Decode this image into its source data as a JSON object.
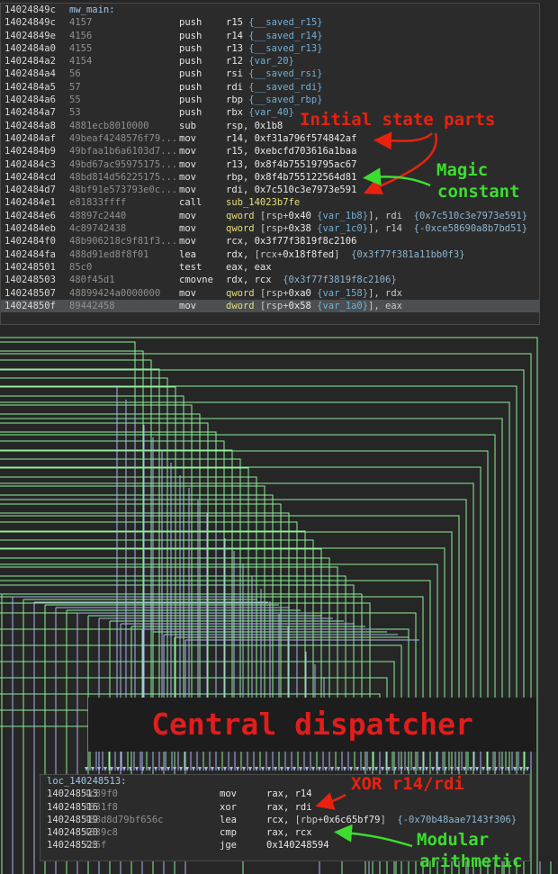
{
  "colors": {
    "background": "#262626",
    "edge_green": "#8eed98",
    "edge_blue": "#a9b4ee",
    "annotation_red": "#e8220f",
    "annotation_green": "#3ddc30",
    "block_bg": "#2b2b2b"
  },
  "top_block": {
    "lines": [
      {
        "addr": "14024849c",
        "label": "mw_main:"
      },
      {
        "addr": "14024849c",
        "bytes": "4157",
        "mnemonic": "push",
        "ops": [
          [
            "r15 ",
            "reg"
          ],
          [
            "{__saved_r15}",
            "var"
          ]
        ]
      },
      {
        "addr": "14024849e",
        "bytes": "4156",
        "mnemonic": "push",
        "ops": [
          [
            "r14 ",
            "reg"
          ],
          [
            "{__saved_r14}",
            "var"
          ]
        ]
      },
      {
        "addr": "1402484a0",
        "bytes": "4155",
        "mnemonic": "push",
        "ops": [
          [
            "r13 ",
            "reg"
          ],
          [
            "{__saved_r13}",
            "var"
          ]
        ]
      },
      {
        "addr": "1402484a2",
        "bytes": "4154",
        "mnemonic": "push",
        "ops": [
          [
            "r12 ",
            "reg"
          ],
          [
            "{var_20}",
            "var"
          ]
        ]
      },
      {
        "addr": "1402484a4",
        "bytes": "56",
        "mnemonic": "push",
        "ops": [
          [
            "rsi ",
            "reg"
          ],
          [
            "{__saved_rsi}",
            "var"
          ]
        ]
      },
      {
        "addr": "1402484a5",
        "bytes": "57",
        "mnemonic": "push",
        "ops": [
          [
            "rdi ",
            "reg"
          ],
          [
            "{__saved_rdi}",
            "var"
          ]
        ]
      },
      {
        "addr": "1402484a6",
        "bytes": "55",
        "mnemonic": "push",
        "ops": [
          [
            "rbp ",
            "reg"
          ],
          [
            "{__saved_rbp}",
            "var"
          ]
        ]
      },
      {
        "addr": "1402484a7",
        "bytes": "53",
        "mnemonic": "push",
        "ops": [
          [
            "rbx ",
            "reg"
          ],
          [
            "{var_40}",
            "var"
          ]
        ]
      },
      {
        "addr": "1402484a8",
        "bytes": "4881ecb8010000",
        "mnemonic": "sub",
        "ops": [
          [
            "rsp, ",
            "reg"
          ],
          [
            "0x1b8",
            "num"
          ]
        ]
      },
      {
        "addr": "1402484af",
        "bytes": "49beaf4248576f79...",
        "mnemonic": "mov",
        "ops": [
          [
            "r14, ",
            "reg"
          ],
          [
            "0xf31a796f574842af",
            "num"
          ]
        ]
      },
      {
        "addr": "1402484b9",
        "bytes": "49bfaa1b6a6103d7...",
        "mnemonic": "mov",
        "ops": [
          [
            "r15, ",
            "reg"
          ],
          [
            "0xebcfd703616a1baa",
            "num"
          ]
        ]
      },
      {
        "addr": "1402484c3",
        "bytes": "49bd67ac95975175...",
        "mnemonic": "mov",
        "ops": [
          [
            "r13, ",
            "reg"
          ],
          [
            "0x8f4b75519795ac67",
            "num"
          ]
        ]
      },
      {
        "addr": "1402484cd",
        "bytes": "48bd814d56225175...",
        "mnemonic": "mov",
        "ops": [
          [
            "rbp, ",
            "reg"
          ],
          [
            "0x8f4b755122564d81",
            "num"
          ]
        ]
      },
      {
        "addr": "1402484d7",
        "bytes": "48bf91e573793e0c...",
        "mnemonic": "mov",
        "ops": [
          [
            "rdi, ",
            "reg"
          ],
          [
            "0x7c510c3e7973e591",
            "num"
          ]
        ]
      },
      {
        "addr": "1402484e1",
        "bytes": "e81833ffff",
        "mnemonic": "call",
        "ops": [
          [
            "sub_14023b7fe",
            "sym"
          ]
        ]
      },
      {
        "addr": "1402484e6",
        "bytes": "48897c2440",
        "mnemonic": "mov",
        "ops": [
          [
            "qword ",
            "kw"
          ],
          [
            "[rsp+",
            "p"
          ],
          [
            "0x40 ",
            "num"
          ],
          [
            "{var_1b8}",
            "var"
          ],
          [
            "], rdi  ",
            "p"
          ],
          [
            "{0x7c510c3e7973e591}",
            "cmt"
          ]
        ]
      },
      {
        "addr": "1402484eb",
        "bytes": "4c89742438",
        "mnemonic": "mov",
        "ops": [
          [
            "qword ",
            "kw"
          ],
          [
            "[rsp+",
            "p"
          ],
          [
            "0x38 ",
            "num"
          ],
          [
            "{var_1c0}",
            "var"
          ],
          [
            "], r14  ",
            "p"
          ],
          [
            "{-0xce58690a8b7bd51}",
            "cmt"
          ]
        ]
      },
      {
        "addr": "1402484f0",
        "bytes": "48b906218c9f81f3...",
        "mnemonic": "mov",
        "ops": [
          [
            "rcx, ",
            "reg"
          ],
          [
            "0x3f77f3819f8c2106",
            "num"
          ]
        ]
      },
      {
        "addr": "1402484fa",
        "bytes": "488d91ed8f8f01",
        "mnemonic": "lea",
        "ops": [
          [
            "rdx, ",
            "reg"
          ],
          [
            "[rcx+",
            "p"
          ],
          [
            "0x18f8fed",
            "num"
          ],
          [
            "]  ",
            "p"
          ],
          [
            "{0x3f77f381a11bb0f3}",
            "cmt"
          ]
        ]
      },
      {
        "addr": "140248501",
        "bytes": "85c0",
        "mnemonic": "test",
        "ops": [
          [
            "eax, eax",
            "reg"
          ]
        ]
      },
      {
        "addr": "140248503",
        "bytes": "480f45d1",
        "mnemonic": "cmovne",
        "ops": [
          [
            "rdx, rcx  ",
            "reg"
          ],
          [
            "{0x3f77f3819f8c2106}",
            "cmt"
          ]
        ]
      },
      {
        "addr": "140248507",
        "bytes": "48899424a0000000",
        "mnemonic": "mov",
        "ops": [
          [
            "qword ",
            "kw"
          ],
          [
            "[rsp+",
            "p"
          ],
          [
            "0xa0 ",
            "num"
          ],
          [
            "{var_158}",
            "var"
          ],
          [
            "], rdx",
            "p"
          ]
        ]
      },
      {
        "addr": "14024850f",
        "bytes": "89442458",
        "mnemonic": "mov",
        "ops": [
          [
            "dword ",
            "kw"
          ],
          [
            "[rsp+",
            "p"
          ],
          [
            "0x58 ",
            "num"
          ],
          [
            "{var_1a0}",
            "var"
          ],
          [
            "], eax",
            "p"
          ]
        ],
        "highlight": true
      }
    ]
  },
  "bottom_block": {
    "lines": [
      {
        "addr": "loc_140248513:",
        "label": ""
      },
      {
        "addr": "140248513",
        "bytes": "4c89f0",
        "mnemonic": "mov",
        "ops": [
          [
            "rax, r14",
            "reg"
          ]
        ]
      },
      {
        "addr": "140248516",
        "bytes": "4831f8",
        "mnemonic": "xor",
        "ops": [
          [
            "rax, rdi",
            "reg"
          ]
        ]
      },
      {
        "addr": "140248519",
        "bytes": "488d8d79bf656c",
        "mnemonic": "lea",
        "ops": [
          [
            "rcx, ",
            "reg"
          ],
          [
            "[rbp+",
            "p"
          ],
          [
            "0x6c65bf79",
            "num"
          ],
          [
            "]  ",
            "p"
          ],
          [
            "{-0x70b48aae7143f306}",
            "cmt"
          ]
        ]
      },
      {
        "addr": "140248520",
        "bytes": "4839c8",
        "mnemonic": "cmp",
        "ops": [
          [
            "rax, rcx",
            "reg"
          ]
        ]
      },
      {
        "addr": "140248523",
        "bytes": "7d6f",
        "mnemonic": "jge",
        "ops": [
          [
            "0x140248594",
            "num"
          ]
        ]
      }
    ]
  },
  "annotations": {
    "initial_state": "Initial state parts",
    "magic_line1": "Magic",
    "magic_line2": "constant",
    "central_dispatcher": "Central dispatcher",
    "xor": "XOR r14/rdi",
    "modular_line1": "Modular",
    "modular_line2": "arithmetic"
  }
}
